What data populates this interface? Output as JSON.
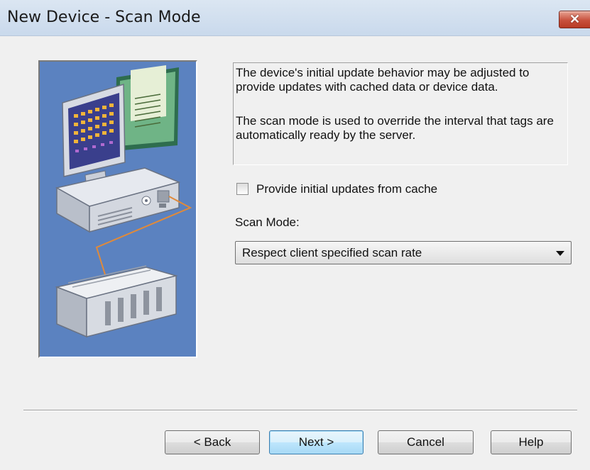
{
  "window": {
    "title": "New Device - Scan Mode",
    "close_glyph": "✕"
  },
  "description": {
    "paragraph1": "The device's initial update behavior may be adjusted to provide updates with cached data or device data.",
    "paragraph2": "The scan mode is used to override the interval that tags are automatically ready by the server."
  },
  "cache_option": {
    "label": "Provide initial updates from cache",
    "checked": false
  },
  "scan_mode": {
    "label": "Scan Mode:",
    "selected": "Respect client specified scan rate"
  },
  "buttons": {
    "back": "< Back",
    "next": "Next >",
    "cancel": "Cancel",
    "help": "Help"
  },
  "colors": {
    "illustration_bg": "#5b82c0",
    "wire": "#e08a3a",
    "title_bar": "#d3e0ef",
    "close": "#c8513d"
  }
}
